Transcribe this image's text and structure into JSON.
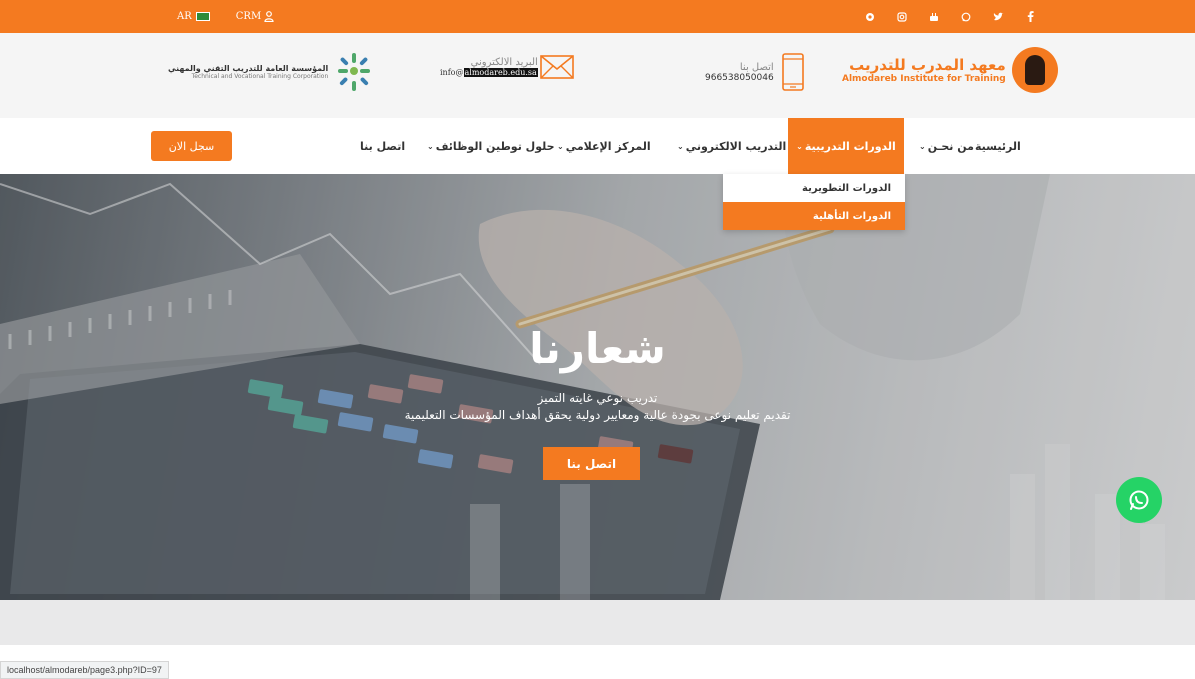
{
  "topbar": {
    "lang_label": "AR",
    "crm_label": "CRM",
    "social_icons": [
      "circle-icon",
      "instagram-icon",
      "youtube-icon",
      "whatsapp-icon",
      "twitter-icon",
      "facebook-icon"
    ]
  },
  "header": {
    "corp_name_ar": "المؤسسة العامة للتدريب التقني والمهني",
    "corp_name_en": "Technical and Vocational Training Corporation",
    "email_label": "البريد الالكتروني",
    "email_prefix": "info@",
    "email_domain": "almodareb.edu.sa",
    "phone_label": "اتصل بنا",
    "phone_value": "966538050046",
    "brand_ar": "معهد المدرب للتدريب",
    "brand_en": "Almodareb Institute for Training"
  },
  "nav": {
    "home": "الرئيسية",
    "about": "من نحـن",
    "courses": "الدورات التدريبية",
    "elearning": "التدريب الالكتروني",
    "media": "المركز الإعلامي",
    "jobs": "حلول توطين الوظائف",
    "contact": "اتصل بنا",
    "register": "سجل الان"
  },
  "dropdown": {
    "item1": "الدورات التطويرية",
    "item2": "الدورات التأهلية"
  },
  "hero": {
    "title": "شعارنا",
    "subtitle1": "تدريب نوعي غايته التميز",
    "subtitle2": "تقديم تعليم نوعى بجودة عالية ومعايير دولية يحقق أهداف المؤسسات التعليمية",
    "button": "اتصل بنا"
  },
  "status_bar": {
    "url": "localhost/almodareb/page3.php?ID=97"
  },
  "colors": {
    "accent": "#f47a20",
    "whatsapp": "#25d366"
  }
}
